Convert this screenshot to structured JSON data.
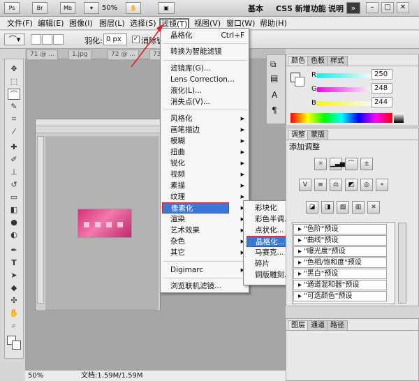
{
  "app_bar": {
    "br": "Br",
    "mb": "Mb",
    "zoom": "50%",
    "workspace_basic": "基本",
    "workspace_new": "CS5 新增功能",
    "workspace_help": "说明",
    "more": "»"
  },
  "menubar": {
    "items": [
      "文件(F)",
      "编辑(E)",
      "图像(I)",
      "图层(L)",
      "选择(S)",
      "滤镜(T)",
      "视图(V)",
      "窗口(W)",
      "帮助(H)"
    ]
  },
  "options": {
    "feather_label": "羽化:",
    "feather_value": "0 px",
    "antialias_label": "消除锯"
  },
  "doc_tabs": [
    "71 @ ...",
    "1.jpg",
    "72 @ ...",
    "73"
  ],
  "filter_menu": {
    "last_filter": "晶格化",
    "last_filter_shortcut": "Ctrl+F",
    "convert_smart": "转换为智能滤镜",
    "gallery": "滤镜库(G)...",
    "lens": "Lens Correction...",
    "liquify": "液化(L)...",
    "vanishing": "消失点(V)...",
    "submenus": [
      "风格化",
      "画笔描边",
      "模糊",
      "扭曲",
      "锐化",
      "视频",
      "素描",
      "纹理",
      "像素化",
      "渲染",
      "艺术效果",
      "杂色",
      "其它"
    ],
    "digimarc": "Digimarc",
    "browse": "浏览联机滤镜..."
  },
  "pixelate_submenu": [
    "彩块化",
    "彩色半调...",
    "点状化...",
    "晶格化...",
    "马赛克...",
    "碎片",
    "铜版雕刻..."
  ],
  "color_panel": {
    "tabs": [
      "颜色",
      "色板",
      "样式"
    ],
    "r_label": "R",
    "g_label": "G",
    "b_label": "B",
    "r_value": "250",
    "g_value": "248",
    "b_value": "244"
  },
  "adjust_panel": {
    "tabs": [
      "调整",
      "蒙版"
    ],
    "title": "添加调整",
    "presets": [
      "\"色阶\"预设",
      "\"曲线\"预设",
      "\"曝光度\"预设",
      "\"色相/饱和度\"预设",
      "\"黑白\"预设",
      "\"通道混和器\"预设",
      "\"可选颜色\"预设"
    ]
  },
  "layers_panel": {
    "tabs": [
      "图层",
      "通道",
      "路径"
    ]
  },
  "status": {
    "zoom": "50%",
    "doc_info": "文档:1.59M/1.59M"
  },
  "colors": {
    "highlight_border": "#e02020",
    "highlight_fill": "#3a78d8",
    "arrow": "#e02020"
  }
}
